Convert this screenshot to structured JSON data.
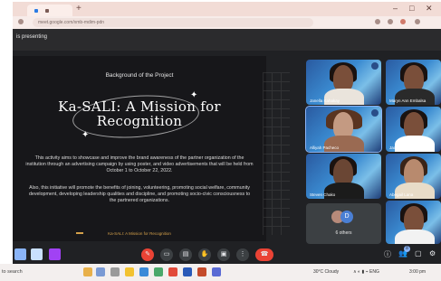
{
  "browser": {
    "url": "meet.google.com/xmb-mdim-pdn",
    "window_min": "–",
    "window_max": "□",
    "window_close": "✕",
    "new_tab": "+"
  },
  "meet": {
    "presenting_label": "is presenting",
    "slide": {
      "subtitle": "Background of the Project",
      "title": "Ka-SALI: A Mission for Recognition",
      "paragraph1": "This activity aims to showcase and improve the brand awareness of the partner organization of the institution through an advertising campaign by using poster, and video advertisements that will be held from October 1 to October 22, 2022.",
      "paragraph2": "Also, this initiative will promote the benefits of joining, volunteering, promoting social welfare, community development, developing leadership qualities and discipline, and promoting socio-civic consciousness to the partnered organizations.",
      "footer": "Ka-SALI: A Mission for Recognition"
    },
    "participants": [
      {
        "name": "Janella Kahakay"
      },
      {
        "name": "Maryn Ann Embalsa"
      },
      {
        "name": "Alliyah Pacheco"
      },
      {
        "name": "Jaco Cabal"
      },
      {
        "name": "Steven Chako"
      },
      {
        "name": "Abegail Lana"
      },
      {
        "name": ""
      }
    ],
    "others": {
      "label": "6 others",
      "avatar_letter": "D"
    },
    "controls": {
      "mic_icon": "✎",
      "cam_icon": "▭",
      "cc_icon": "▤",
      "hand_icon": "✋",
      "present_icon": "▣",
      "more_icon": "⋮",
      "end_icon": "☎",
      "info_icon": "ⓘ",
      "people_icon": "👥",
      "people_count": "8",
      "chat_icon": "▢",
      "activities_icon": "⚙"
    }
  },
  "taskbar": {
    "search_label": "to search",
    "weather": "30°C Cloudy",
    "tray": "∧ ◐ ▮ ⌁ ENG",
    "time": "3:00 pm"
  },
  "colors": {
    "meet_bg": "#202124",
    "end_call": "#ea4335",
    "slide_accent": "#d4a04a",
    "purple_tile": "#a142f4"
  }
}
